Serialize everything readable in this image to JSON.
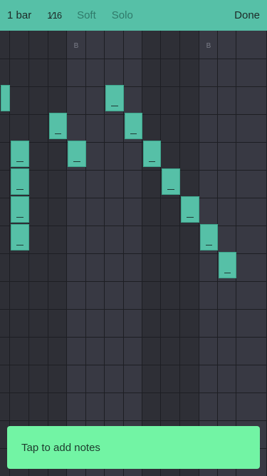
{
  "toolbar": {
    "length_label": "1 bar",
    "step_label": "1⁄16",
    "soft_label": "Soft",
    "solo_label": "Solo",
    "done_label": "Done"
  },
  "grid": {
    "columns": 14,
    "rows": 15,
    "beat_markers": [
      {
        "column": 4,
        "label": "B"
      },
      {
        "column": 11,
        "label": "B"
      }
    ],
    "notes": [
      {
        "column": 0,
        "row": 2
      },
      {
        "column": 1,
        "row": 4
      },
      {
        "column": 1,
        "row": 5
      },
      {
        "column": 1,
        "row": 6
      },
      {
        "column": 1,
        "row": 7
      },
      {
        "column": 3,
        "row": 3
      },
      {
        "column": 4,
        "row": 4
      },
      {
        "column": 6,
        "row": 2
      },
      {
        "column": 7,
        "row": 3
      },
      {
        "column": 8,
        "row": 4
      },
      {
        "column": 9,
        "row": 5
      },
      {
        "column": 10,
        "row": 6
      },
      {
        "column": 11,
        "row": 7
      },
      {
        "column": 12,
        "row": 8
      }
    ],
    "colors": {
      "note": "#56c0a7",
      "toolbar": "#56c0a7",
      "toast": "#72f4a4"
    }
  },
  "toast": {
    "message": "Tap to add notes"
  }
}
